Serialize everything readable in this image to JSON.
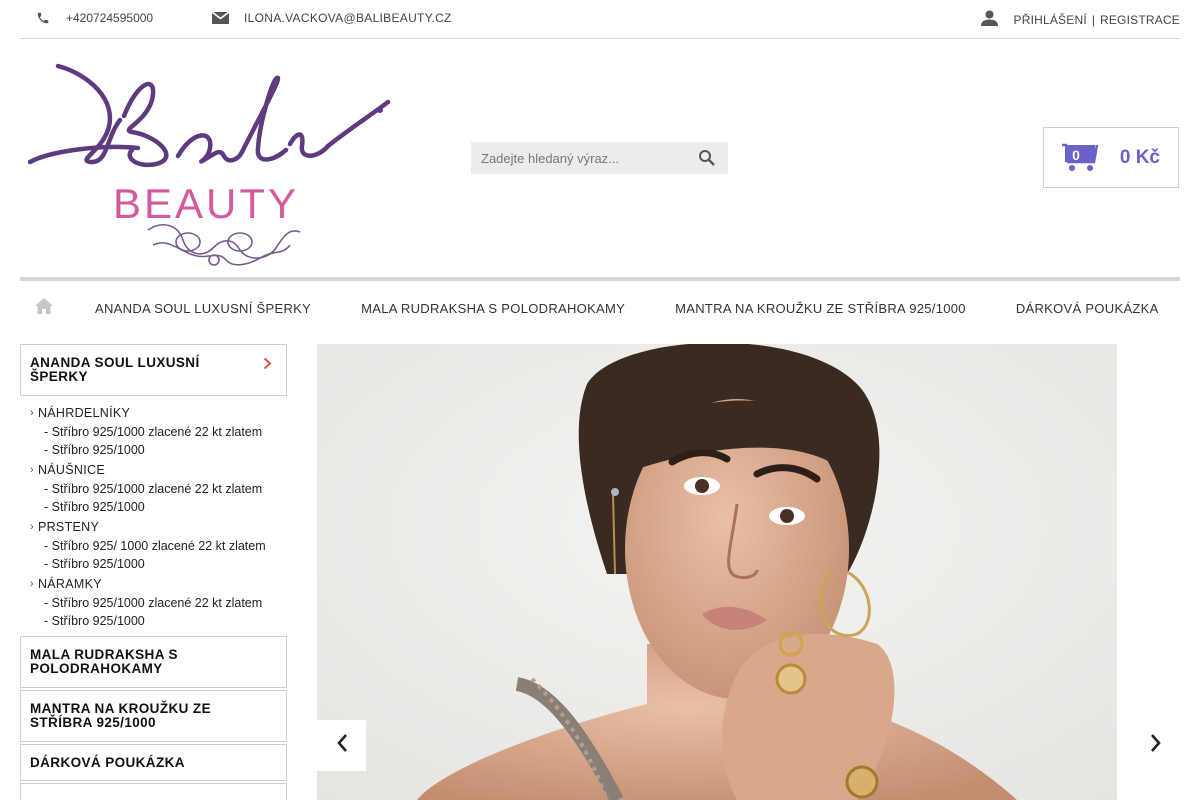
{
  "topbar": {
    "phone": "+420724595000",
    "email": "ILONA.VACKOVA@BALIBEAUTY.CZ",
    "login": "PŘIHLÁŠENÍ",
    "register": "REGISTRACE",
    "separator": "|"
  },
  "logo": {
    "script_text": "Bali",
    "brand_text": "BEAUTY"
  },
  "search": {
    "placeholder": "Zadejte hledaný výraz..."
  },
  "cart": {
    "count": "0",
    "total": "0 Kč"
  },
  "nav": {
    "items": [
      "ANANDA SOUL LUXUSNÍ ŠPERKY",
      "MALA RUDRAKSHA S POLODRAHOKAMY",
      "MANTRA NA KROUŽKU ZE STŘÍBRA 925/1000",
      "DÁRKOVÁ POUKÁZKA"
    ]
  },
  "sidebar": {
    "active_category": "ANANDA SOUL LUXUSNÍ ŠPERKY",
    "groups": [
      {
        "label": "NÁHRDELNÍKY",
        "items": [
          "- Stříbro 925/1000 zlacené 22 kt zlatem",
          "- Stříbro 925/1000"
        ]
      },
      {
        "label": "NÁUŠNICE",
        "items": [
          "- Stříbro 925/1000 zlacené 22 kt zlatem",
          "- Stříbro 925/1000"
        ]
      },
      {
        "label": "PRSTENY",
        "items": [
          "- Stříbro 925/ 1000 zlacené 22 kt zlatem",
          "- Stříbro 925/1000"
        ]
      },
      {
        "label": "NÁRAMKY",
        "items": [
          "- Stříbro 925/1000 zlacené 22 kt zlatem",
          "- Stříbro 925/1000"
        ]
      }
    ],
    "categories": [
      "MALA RUDRAKSHA S POLODRAHOKAMY",
      "MANTRA NA KROUŽKU ZE STŘÍBRA 925/1000",
      "DÁRKOVÁ POUKÁZKA"
    ]
  },
  "colors": {
    "accent_purple": "#6b62c9",
    "logo_purple": "#5e3a7e",
    "logo_pink": "#d45a9c",
    "chevron_red": "#e0524f"
  },
  "icons": {
    "phone": "phone-icon",
    "email": "envelope-icon",
    "user": "user-icon",
    "search": "search-icon",
    "cart": "cart-icon",
    "home": "home-icon",
    "prev": "chevron-left-icon",
    "next": "chevron-right-icon"
  }
}
